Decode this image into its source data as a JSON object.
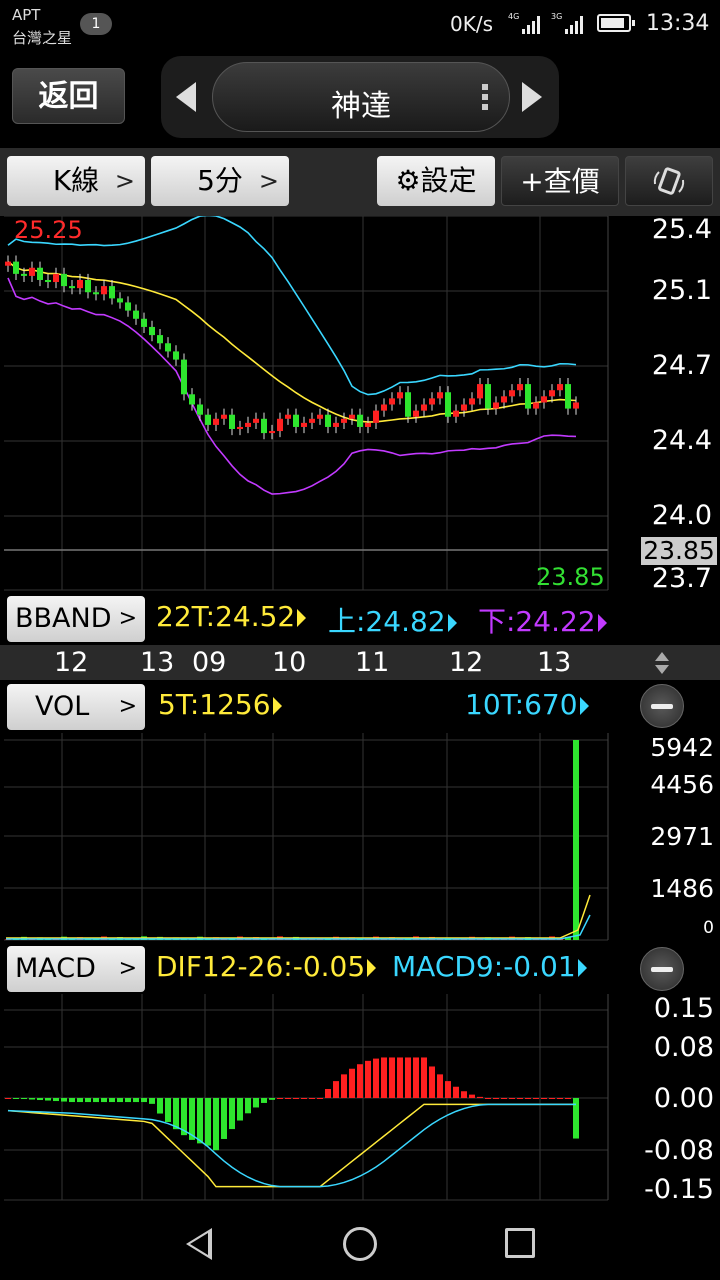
{
  "status_bar": {
    "carrier_line1": "APT",
    "carrier_line2": "台灣之星",
    "notification_count": "1",
    "net_speed": "0K/s",
    "signal1_label": "4G",
    "signal2_label": "3G",
    "battery_level": 0.9,
    "time": "13:34"
  },
  "header": {
    "back_label": "返回",
    "stock_name": "神達"
  },
  "toolbar": {
    "kline_label": "K線",
    "period_label": "5分",
    "settings_label": "設定",
    "quote_label": "+查價"
  },
  "price_chart": {
    "axis_labels": [
      "25.4",
      "25.1",
      "24.7",
      "24.4",
      "24.0",
      "23.7"
    ],
    "max_label": "25.25",
    "min_label": "23.85",
    "last_price": "23.85"
  },
  "bband": {
    "button_label": "BBAND",
    "mid_text": "22T:24.52",
    "upper_text": "上:24.82",
    "lower_text": "下:24.22",
    "colors": {
      "mid": "#ffea3a",
      "upper": "#3ad7ff",
      "lower": "#c23aff"
    }
  },
  "time_axis": {
    "labels": [
      "12",
      "13",
      "09",
      "10",
      "11",
      "12",
      "13"
    ]
  },
  "volume": {
    "button_label": "VOL",
    "ma5_text": "5T:1256",
    "ma10_text": "10T:670",
    "axis_labels": [
      "5942",
      "4456",
      "2971",
      "1486",
      "0"
    ]
  },
  "macd": {
    "button_label": "MACD",
    "dif_text": "DIF12-26:-0.05",
    "macd_text": "MACD9:-0.01",
    "axis_labels": [
      "0.15",
      "0.08",
      "0.00",
      "-0.08",
      "-0.15"
    ]
  },
  "chart_data": [
    {
      "type": "candlestick",
      "title": "",
      "y_axis_ticks": [
        25.4,
        25.1,
        24.7,
        24.4,
        24.0,
        23.7
      ],
      "ylim": [
        23.65,
        25.42
      ],
      "x_ticks": [
        "12",
        "13",
        "09",
        "10",
        "11",
        "12",
        "13"
      ],
      "series_overlays": [
        "22T",
        "上",
        "下"
      ],
      "high": 25.25,
      "low": 23.85,
      "last": 23.85
    },
    {
      "type": "bar",
      "title": "",
      "y_axis_ticks": [
        5942,
        4456,
        2971,
        1486,
        0
      ],
      "ylim": [
        0,
        5942
      ],
      "last_value": 5942
    },
    {
      "type": "bar",
      "title": "",
      "y_axis_ticks": [
        0.15,
        0.08,
        0.0,
        -0.08,
        -0.15
      ],
      "ylim": [
        -0.15,
        0.15
      ]
    }
  ]
}
